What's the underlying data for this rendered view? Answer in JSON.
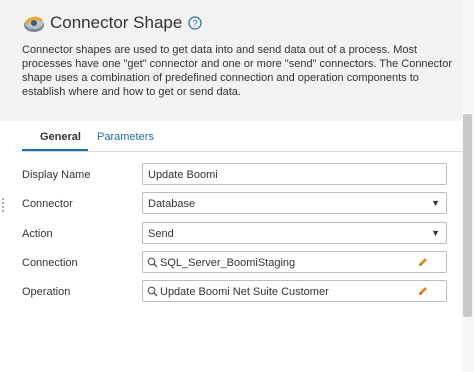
{
  "header": {
    "title": "Connector Shape",
    "description": "Connector shapes are used to get data into and send data out of a process. Most processes have one \"get\" connector and one or more \"send\" connectors. The Connector shape uses a combination of predefined connection and operation components to establish where and how to get or send data."
  },
  "tabs": [
    {
      "label": "General",
      "active": true
    },
    {
      "label": "Parameters",
      "active": false
    }
  ],
  "form": {
    "display_name": {
      "label": "Display Name",
      "value": "Update Boomi"
    },
    "connector": {
      "label": "Connector",
      "value": "Database"
    },
    "action": {
      "label": "Action",
      "value": "Send"
    },
    "connection": {
      "label": "Connection",
      "value": "SQL_Server_BoomiStaging"
    },
    "operation": {
      "label": "Operation",
      "value": "Update Boomi Net Suite Customer"
    }
  },
  "colors": {
    "accent": "#1f6fa8",
    "header_bg": "#f2f2f2",
    "pencil": "#e08a1e"
  },
  "icons": {
    "shape": "connector-shape-icon",
    "help": "help-circle-icon",
    "search": "search-icon",
    "edit": "pencil-icon",
    "dropdown": "caret-down-icon"
  }
}
